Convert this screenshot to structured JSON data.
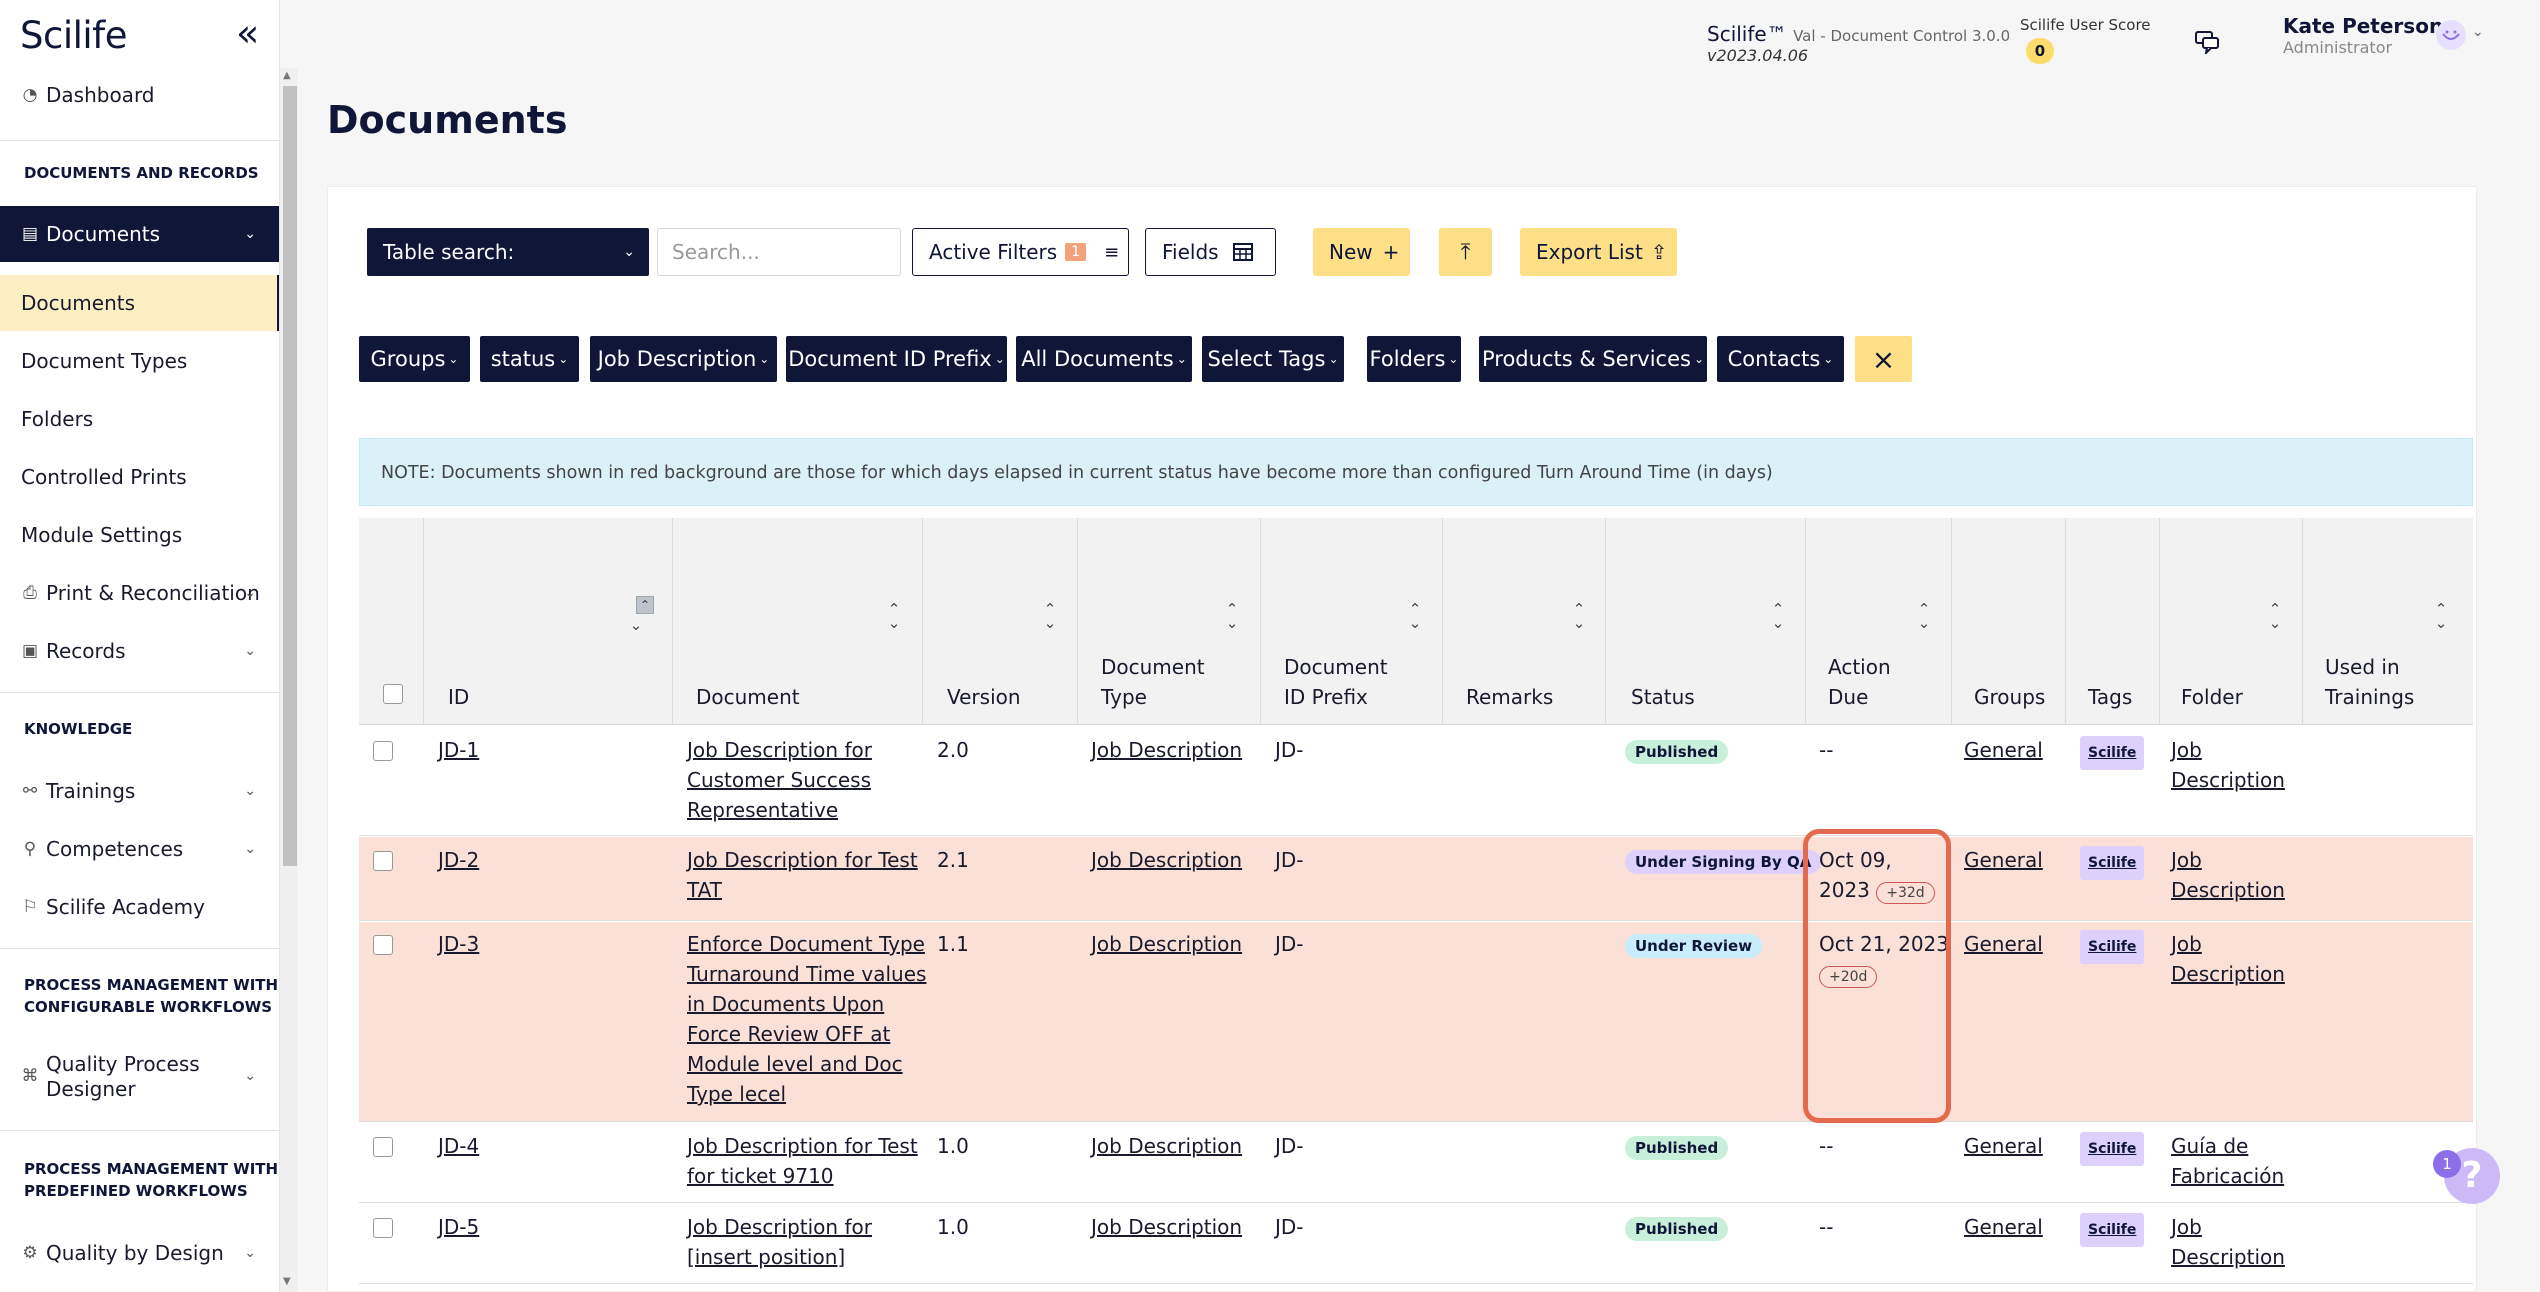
{
  "app": {
    "logo": "Scilife",
    "name": "Scilife™",
    "module": "Val - Document Control 3.0.0",
    "version": "v2023.04.06",
    "score_label": "Scilife User Score",
    "score": "0",
    "user_name": "Kate Peterson",
    "user_role": "Administrator"
  },
  "sidebar": {
    "dashboard": "Dashboard",
    "sec_docs": "DOCUMENTS AND RECORDS",
    "documents": "Documents",
    "sub_documents": "Documents",
    "document_types": "Document Types",
    "folders": "Folders",
    "controlled_prints": "Controlled Prints",
    "module_settings": "Module Settings",
    "print_reconciliation": "Print & Reconciliation",
    "records": "Records",
    "sec_knowledge": "KNOWLEDGE",
    "trainings": "Trainings",
    "competences": "Competences",
    "academy": "Scilife Academy",
    "sec_pm_config_1": "PROCESS MANAGEMENT WITH",
    "sec_pm_config_2": "CONFIGURABLE WORKFLOWS",
    "qpd_1": "Quality Process",
    "qpd_2": "Designer",
    "sec_pm_pre_1": "PROCESS MANAGEMENT WITH",
    "sec_pm_pre_2": "PREDEFINED WORKFLOWS",
    "qbd": "Quality by Design"
  },
  "page": {
    "title": "Documents"
  },
  "toolbar": {
    "table_search": "Table search:",
    "search_placeholder": "Search...",
    "active_filters": "Active Filters",
    "active_filters_count": "1",
    "fields": "Fields",
    "new": "New",
    "export": "Export List"
  },
  "filters": [
    "Groups",
    "status",
    "Job Description",
    "Document ID Prefix",
    "All Documents",
    "Select Tags",
    "Folders",
    "Products & Services",
    "Contacts"
  ],
  "note": "NOTE: Documents shown in red background are those for which days elapsed in current status have become more than configured Turn Around Time (in days)",
  "columns": {
    "id": "ID",
    "document": "Document",
    "version": "Version",
    "doc_type_1": "Document",
    "doc_type_2": "Type",
    "prefix_1": "Document",
    "prefix_2": "ID Prefix",
    "remarks": "Remarks",
    "status": "Status",
    "due_1": "Action",
    "due_2": "Due",
    "groups": "Groups",
    "tags": "Tags",
    "folder": "Folder",
    "trainings_1": "Used in",
    "trainings_2": "Trainings"
  },
  "rows": [
    {
      "id": "JD-1",
      "doc": [
        "Job Description for",
        "Customer Success",
        "Representative"
      ],
      "version": "2.0",
      "type": "Job Description",
      "prefix": "JD-",
      "status": "Published",
      "due": [
        "--"
      ],
      "due_badge": "",
      "group": "General",
      "tag": "Scilife",
      "folder": [
        " Job",
        "Description"
      ],
      "red": false
    },
    {
      "id": "JD-2",
      "doc": [
        "Job Description for Test",
        "TAT"
      ],
      "version": "2.1",
      "type": "Job Description",
      "prefix": "JD-",
      "status": "Under Signing By QA",
      "due": [
        "Oct 09,",
        "2023"
      ],
      "due_badge": "+32d",
      "group": "General",
      "tag": "Scilife",
      "folder": [
        " Job",
        "Description"
      ],
      "red": true
    },
    {
      "id": "JD-3",
      "doc": [
        "Enforce Document Type",
        "Turnaround Time values",
        "in Documents Upon",
        "Force Review OFF at",
        "Module level and Doc",
        "Type lecel"
      ],
      "version": "1.1",
      "type": "Job Description",
      "prefix": "JD-",
      "status": "Under Review",
      "due": [
        "Oct 21, 2023"
      ],
      "due_badge": "+20d",
      "group": "General",
      "tag": "Scilife",
      "folder": [
        " Job",
        "Description"
      ],
      "red": true
    },
    {
      "id": "JD-4",
      "doc": [
        "Job Description for Test",
        "for ticket 9710"
      ],
      "version": "1.0",
      "type": "Job Description",
      "prefix": "JD-",
      "status": "Published",
      "due": [
        "--"
      ],
      "due_badge": "",
      "group": "General",
      "tag": "Scilife",
      "folder": [
        " Guía de",
        "Fabricación"
      ],
      "red": false
    },
    {
      "id": "JD-5",
      "doc": [
        "Job Description for",
        "[insert position]"
      ],
      "version": "1.0",
      "type": "Job Description",
      "prefix": "JD-",
      "status": "Published",
      "due": [
        "--"
      ],
      "due_badge": "",
      "group": "General",
      "tag": "Scilife",
      "folder": [
        " Job",
        "Description"
      ],
      "red": false
    }
  ],
  "help": {
    "badge": "1",
    "symbol": "?"
  },
  "colors": {
    "navy": "#0f1638",
    "yellow": "#fcdf87",
    "red_row": "#fbe0d7",
    "highlight": "#e46a4f"
  }
}
